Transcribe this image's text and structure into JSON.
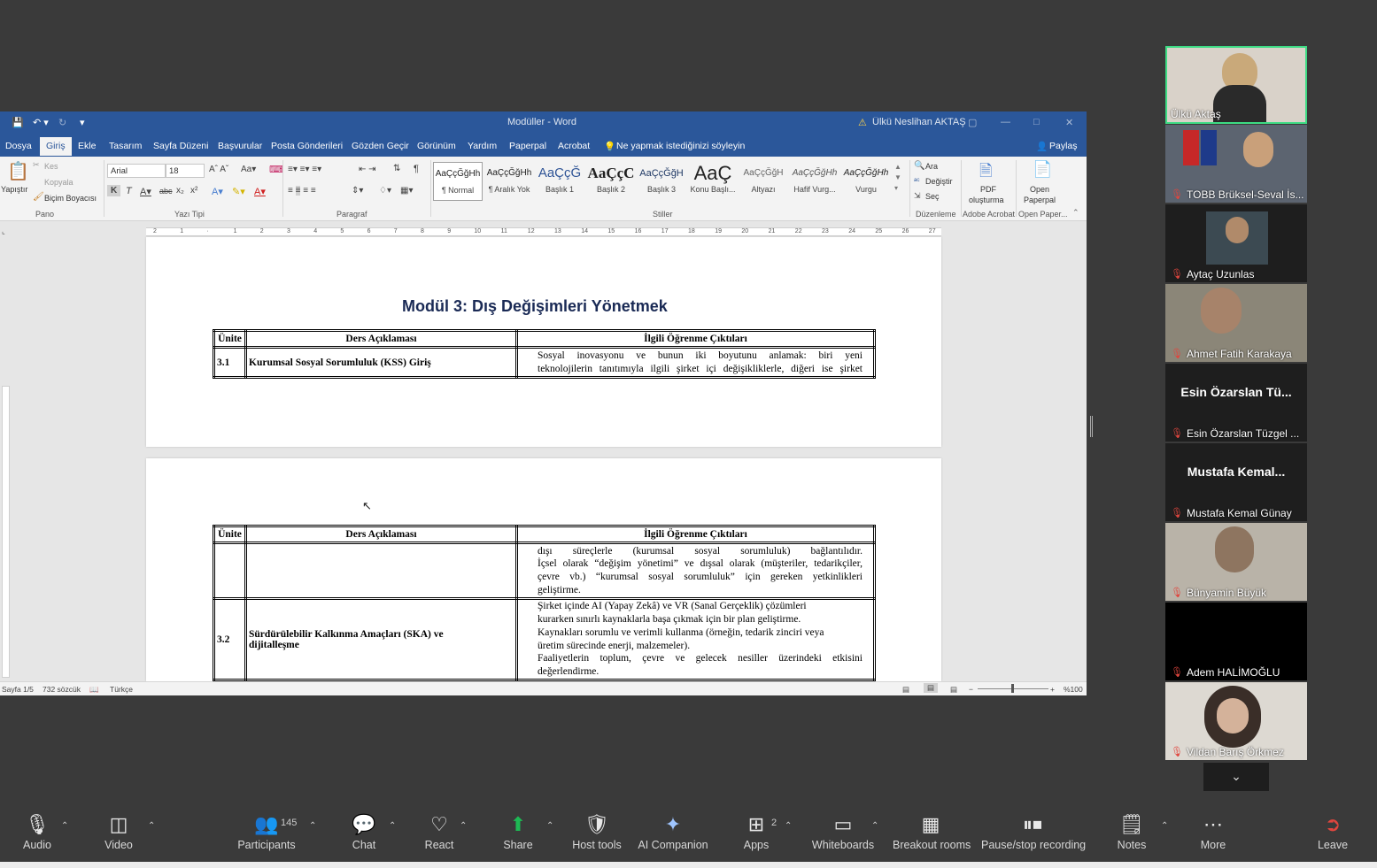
{
  "word": {
    "title": "Modüller  -  Word",
    "user": "Ülkü Neslihan AKTAŞ",
    "menu": [
      "Dosya",
      "Giriş",
      "Ekle",
      "Tasarım",
      "Sayfa Düzeni",
      "Başvurular",
      "Posta Gönderileri",
      "Gözden Geçir",
      "Görünüm",
      "Yardım",
      "Paperpal",
      "Acrobat"
    ],
    "tell_me": "Ne yapmak istediğinizi söyleyin",
    "share": "Paylaş",
    "clipboard": {
      "paste": "Yapıştır",
      "cut": "Kes",
      "copy": "Kopyala",
      "format_painter": "Biçim Boyacısı",
      "group": "Pano"
    },
    "font": {
      "name": "Arial",
      "size": "18",
      "group": "Yazı Tipi"
    },
    "paragraph_group": "Paragraf",
    "styles": [
      {
        "preview": "AaÇçĞğHh",
        "name": "¶ Normal"
      },
      {
        "preview": "AaÇçĞğHh",
        "name": "¶ Aralık Yok"
      },
      {
        "preview": "AaÇçĞ",
        "name": "Başlık 1"
      },
      {
        "preview": "AaÇçC",
        "name": "Başlık 2"
      },
      {
        "preview": "AaÇçĞğH",
        "name": "Başlık 3"
      },
      {
        "preview": "AaÇ",
        "name": "Konu Başlı..."
      },
      {
        "preview": "AaÇçĞğH",
        "name": "Altyazı"
      },
      {
        "preview": "AaÇçĞğHh",
        "name": "Hafif Vurg..."
      },
      {
        "preview": "AaÇçĞğHh",
        "name": "Vurgu"
      }
    ],
    "styles_group": "Stiller",
    "editing": {
      "find": "Ara",
      "replace": "Değiştir",
      "select": "Seç",
      "group": "Düzenleme"
    },
    "pdf": {
      "label1": "PDF",
      "label2": "oluşturma",
      "group": "Adobe Acrobat"
    },
    "paperpal": {
      "label1": "Open",
      "label2": "Paperpal",
      "group": "Open Paper..."
    },
    "status": {
      "page": "Sayfa 1/5",
      "words": "732 sözcük",
      "lang": "Türkçe",
      "zoom": "%100"
    }
  },
  "document": {
    "title": "Modül 3: Dış Değişimleri Yönetmek",
    "headers": [
      "Ünite",
      "Ders Açıklaması",
      "İlgili Öğrenme Çıktıları"
    ],
    "table1_row": {
      "unit": "3.1",
      "desc": "Kurumsal Sosyal Sorumluluk (KSS) Giriş",
      "out1": "Sosyal inovasyonu ve bunun iki boyutunu anlamak: biri yeni",
      "out2": "teknolojilerin tanıtımıyla ilgili şirket içi değişikliklerle, diğeri ise şirket"
    },
    "table2_row1": {
      "l1": "dışı süreçlerle (kurumsal sosyal sorumluluk) bağlantılıdır.",
      "l2": "İçsel olarak “değişim yönetimi” ve dışsal olarak (müşteriler, tedarikçiler,",
      "l3": "çevre vb.) “kurumsal sosyal sorumluluk” için gereken yetkinlikleri",
      "l4": "geliştirme."
    },
    "table2_row2": {
      "unit": "3.2",
      "desc1": "Sürdürülebilir Kalkınma Amaçları (SKA) ve",
      "desc2": "dijitalleşme",
      "l1": "Şirket içinde AI (Yapay Zekâ) ve VR (Sanal Gerçeklik) çözümleri",
      "l2": "kurarken sınırlı kaynaklarla başa çıkmak için bir plan geliştirme.",
      "l3": "Kaynakları sorumlu ve verimli kullanma (örneğin, tedarik zinciri veya",
      "l4": "üretim sürecinde enerji, malzemeler).",
      "l5": "Faaliyetlerin toplum, çevre ve gelecek nesiller üzerindeki etkisini",
      "l6": "değerlendirme."
    }
  },
  "participants": [
    {
      "name": "Ülkü Aktaş",
      "video": true,
      "muted": false
    },
    {
      "name": "TOBB Brüksel-Seval İs...",
      "video": true,
      "muted": true
    },
    {
      "name": "Aytaç Uzunlas",
      "video": true,
      "muted": true
    },
    {
      "name": "Ahmet Fatih Karakaya",
      "video": true,
      "muted": true
    },
    {
      "name": "Esin Özarslan Tüzgel ...",
      "video": false,
      "big": "Esin Özarslan Tü...",
      "muted": true
    },
    {
      "name": "Mustafa Kemal Günay",
      "video": false,
      "big": "Mustafa Kemal...",
      "muted": true
    },
    {
      "name": "Bünyamin Büyük",
      "video": true,
      "muted": true
    },
    {
      "name": "Adem HALİMOĞLU",
      "video": false,
      "muted": true
    },
    {
      "name": "Vildan Barış Örkmez",
      "video": true,
      "muted": true
    }
  ],
  "toolbar": {
    "audio": "Audio",
    "video": "Video",
    "participants": "Participants",
    "participants_count": "145",
    "chat": "Chat",
    "react": "React",
    "share": "Share",
    "host_tools": "Host tools",
    "ai_companion": "AI Companion",
    "apps": "Apps",
    "apps_count": "2",
    "whiteboards": "Whiteboards",
    "breakout": "Breakout rooms",
    "recording": "Pause/stop recording",
    "notes": "Notes",
    "more": "More",
    "leave": "Leave"
  },
  "colors": {
    "word_blue": "#2b579a",
    "share_green": "#1db954",
    "active_speaker": "#3ddc84",
    "muted_red": "#e0463e"
  }
}
